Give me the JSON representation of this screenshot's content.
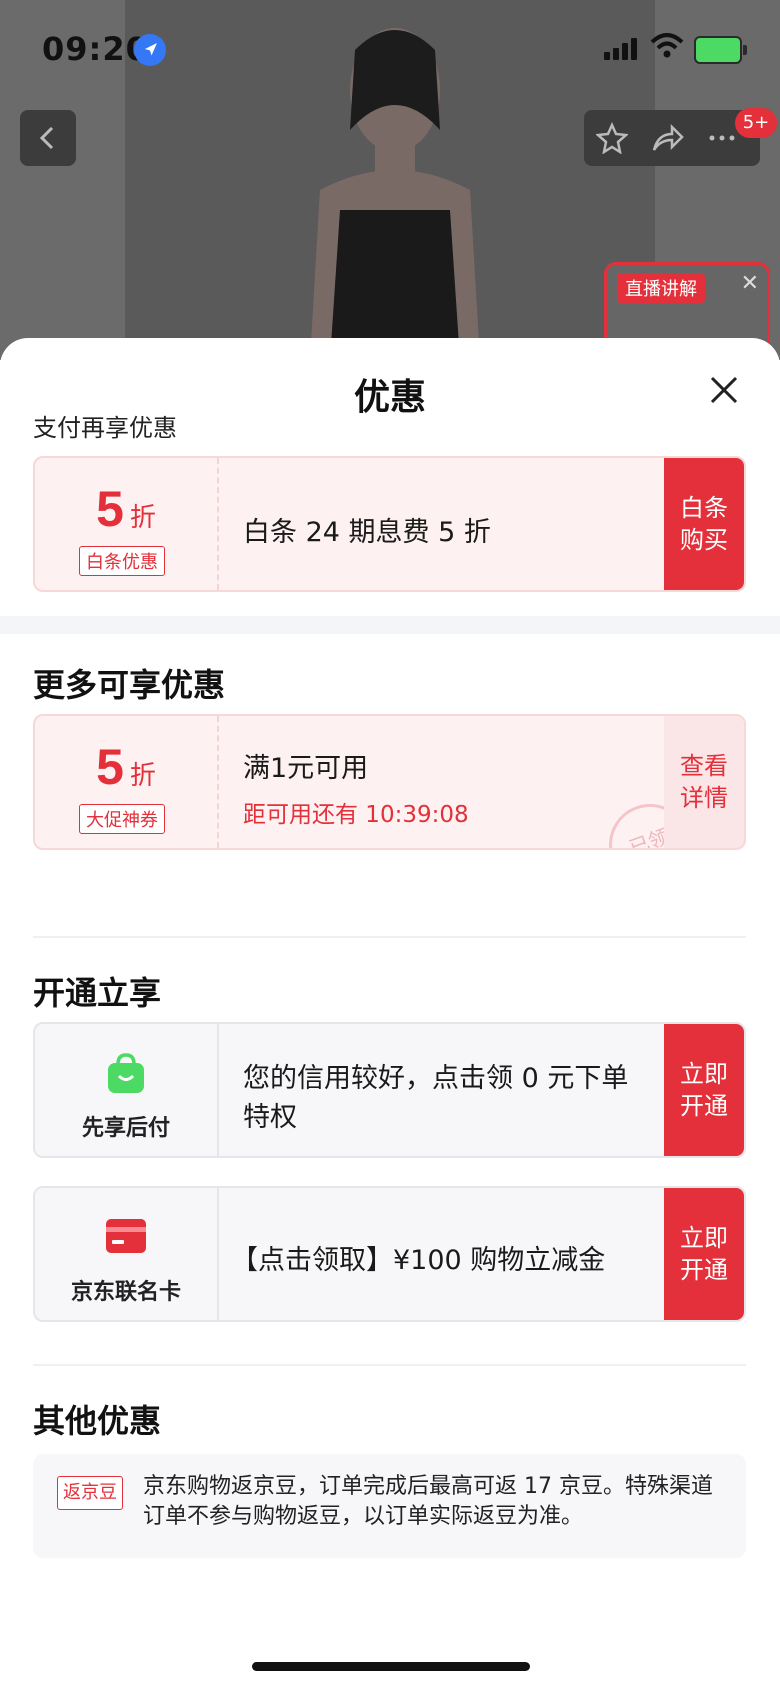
{
  "status_bar": {
    "time": "09:20"
  },
  "top_bar": {
    "badge": "5+"
  },
  "live_float": {
    "tag": "直播讲解"
  },
  "sheet": {
    "title": "优惠",
    "pay_section": {
      "heading": "支付再享优惠",
      "card": {
        "discount_num": "5",
        "discount_unit": "折",
        "tag": "白条优惠",
        "desc": "白条 24 期息费 5 折",
        "action_line1": "白条",
        "action_line2": "购买"
      }
    },
    "more_section": {
      "heading": "更多可享优惠",
      "card": {
        "discount_num": "5",
        "discount_unit": "折",
        "tag": "大促神券",
        "desc": "满1元可用",
        "sub": "距可用还有 10:39:08",
        "stamp": "已领",
        "action_line1": "查看",
        "action_line2": "详情"
      }
    },
    "open_section": {
      "heading": "开通立享",
      "cards": [
        {
          "label": "先享后付",
          "icon": "shopping-bag-icon",
          "desc_line1": "您的信用较好，点击领 0 元下单",
          "desc_line2": "特权",
          "action_line1": "立即",
          "action_line2": "开通"
        },
        {
          "label": "京东联名卡",
          "icon": "credit-card-icon",
          "desc_line1": "【点击领取】¥100 购物立减金",
          "action_line1": "立即",
          "action_line2": "开通"
        }
      ]
    },
    "other_section": {
      "heading": "其他优惠",
      "tag": "返京豆",
      "text": "京东购物返京豆，订单完成后最高可返 17 京豆。特殊渠道订单不参与购物返豆，以订单实际返豆为准。"
    }
  },
  "colors": {
    "accent": "#e3303a",
    "green": "#4cd964"
  }
}
